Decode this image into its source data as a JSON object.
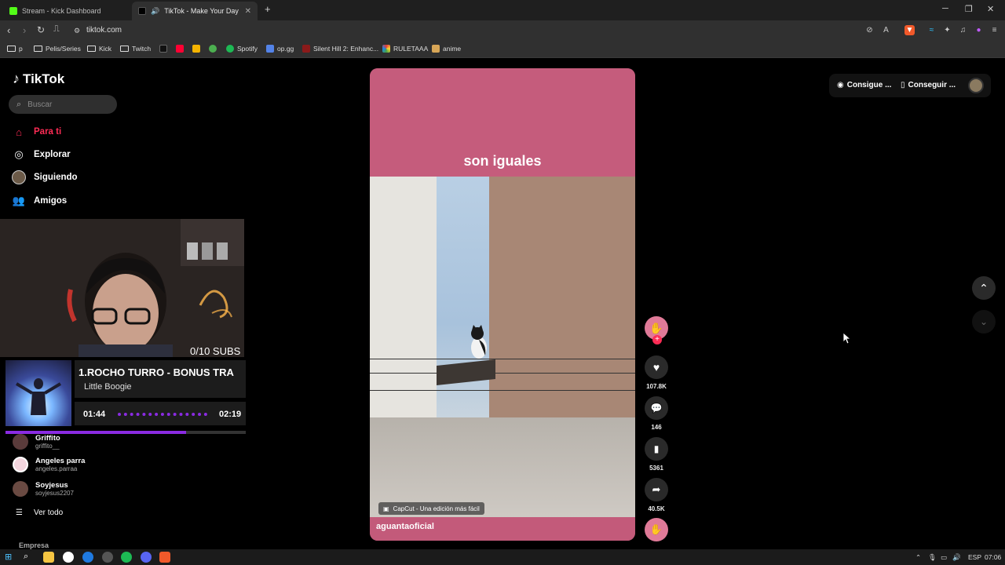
{
  "browser": {
    "tabs": [
      {
        "title": "Stream - Kick Dashboard",
        "active": false
      },
      {
        "title": "TikTok - Make Your Day",
        "active": true
      }
    ],
    "url": "tiktok.com",
    "bookmarks": [
      {
        "label": "p",
        "type": "folder"
      },
      {
        "label": "Pelis/Series",
        "type": "folder"
      },
      {
        "label": "Kick",
        "type": "folder"
      },
      {
        "label": "Twitch",
        "type": "folder"
      },
      {
        "label": "Spotify",
        "type": "link"
      },
      {
        "label": "op.gg",
        "type": "link"
      },
      {
        "label": "Silent Hill 2: Enhanc...",
        "type": "link"
      },
      {
        "label": "RULETAAA",
        "type": "link"
      },
      {
        "label": "anime",
        "type": "link"
      }
    ]
  },
  "sidebar": {
    "logo": "TikTok",
    "search_placeholder": "Buscar",
    "nav": [
      {
        "label": "Para ti",
        "icon": "home-icon",
        "active": true
      },
      {
        "label": "Explorar",
        "icon": "compass-icon",
        "active": false
      },
      {
        "label": "Siguiendo",
        "icon": "following-avatar-icon",
        "active": false
      },
      {
        "label": "Amigos",
        "icon": "friends-icon",
        "active": false
      }
    ],
    "following": [
      {
        "name": "Griffito",
        "username": "griffito__"
      },
      {
        "name": "Angeles parra",
        "username": "angeles.parraa"
      },
      {
        "name": "Soyjesus",
        "username": "soyjesus2207"
      }
    ],
    "see_all": "Ver todo",
    "footer": "Empresa"
  },
  "overlay": {
    "subs": "0/10 SUBS",
    "song_title": "1.ROCHO TURRO - BONUS TRA",
    "song_artist": "Little Boogie",
    "time_current": "01:44",
    "time_total": "02:19",
    "progress": 0.75
  },
  "video": {
    "caption": "son iguales",
    "watermark": "CapCut - Una edición más fácil",
    "author": "aguantaoficial"
  },
  "actions": {
    "likes": "107.8K",
    "comments": "146",
    "saves": "5361",
    "shares": "40.5K"
  },
  "topright": {
    "btn1": "Consigue ...",
    "btn2": "Conseguir ..."
  },
  "taskbar": {
    "lang": "ESP",
    "time": "07:06"
  },
  "colors": {
    "tiktok_red": "#fe2c55",
    "video_pink": "#c35a7a",
    "music_purple": "#8a2be2"
  }
}
